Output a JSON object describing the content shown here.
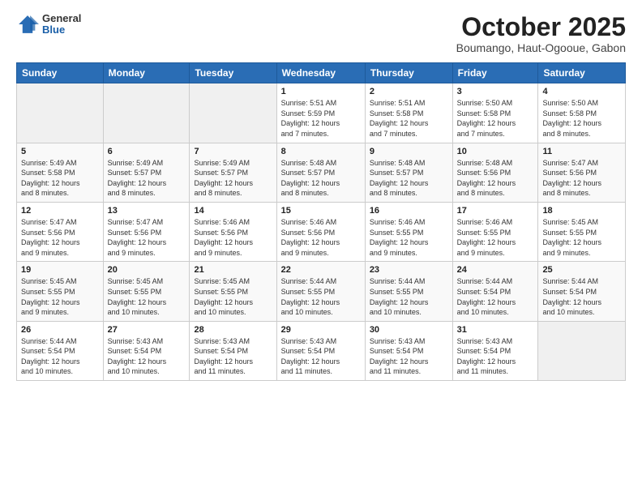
{
  "logo": {
    "general": "General",
    "blue": "Blue"
  },
  "header": {
    "month": "October 2025",
    "location": "Boumango, Haut-Ogooue, Gabon"
  },
  "weekdays": [
    "Sunday",
    "Monday",
    "Tuesday",
    "Wednesday",
    "Thursday",
    "Friday",
    "Saturday"
  ],
  "weeks": [
    [
      {
        "day": "",
        "info": ""
      },
      {
        "day": "",
        "info": ""
      },
      {
        "day": "",
        "info": ""
      },
      {
        "day": "1",
        "info": "Sunrise: 5:51 AM\nSunset: 5:59 PM\nDaylight: 12 hours\nand 7 minutes."
      },
      {
        "day": "2",
        "info": "Sunrise: 5:51 AM\nSunset: 5:58 PM\nDaylight: 12 hours\nand 7 minutes."
      },
      {
        "day": "3",
        "info": "Sunrise: 5:50 AM\nSunset: 5:58 PM\nDaylight: 12 hours\nand 7 minutes."
      },
      {
        "day": "4",
        "info": "Sunrise: 5:50 AM\nSunset: 5:58 PM\nDaylight: 12 hours\nand 8 minutes."
      }
    ],
    [
      {
        "day": "5",
        "info": "Sunrise: 5:49 AM\nSunset: 5:58 PM\nDaylight: 12 hours\nand 8 minutes."
      },
      {
        "day": "6",
        "info": "Sunrise: 5:49 AM\nSunset: 5:57 PM\nDaylight: 12 hours\nand 8 minutes."
      },
      {
        "day": "7",
        "info": "Sunrise: 5:49 AM\nSunset: 5:57 PM\nDaylight: 12 hours\nand 8 minutes."
      },
      {
        "day": "8",
        "info": "Sunrise: 5:48 AM\nSunset: 5:57 PM\nDaylight: 12 hours\nand 8 minutes."
      },
      {
        "day": "9",
        "info": "Sunrise: 5:48 AM\nSunset: 5:57 PM\nDaylight: 12 hours\nand 8 minutes."
      },
      {
        "day": "10",
        "info": "Sunrise: 5:48 AM\nSunset: 5:56 PM\nDaylight: 12 hours\nand 8 minutes."
      },
      {
        "day": "11",
        "info": "Sunrise: 5:47 AM\nSunset: 5:56 PM\nDaylight: 12 hours\nand 8 minutes."
      }
    ],
    [
      {
        "day": "12",
        "info": "Sunrise: 5:47 AM\nSunset: 5:56 PM\nDaylight: 12 hours\nand 9 minutes."
      },
      {
        "day": "13",
        "info": "Sunrise: 5:47 AM\nSunset: 5:56 PM\nDaylight: 12 hours\nand 9 minutes."
      },
      {
        "day": "14",
        "info": "Sunrise: 5:46 AM\nSunset: 5:56 PM\nDaylight: 12 hours\nand 9 minutes."
      },
      {
        "day": "15",
        "info": "Sunrise: 5:46 AM\nSunset: 5:56 PM\nDaylight: 12 hours\nand 9 minutes."
      },
      {
        "day": "16",
        "info": "Sunrise: 5:46 AM\nSunset: 5:55 PM\nDaylight: 12 hours\nand 9 minutes."
      },
      {
        "day": "17",
        "info": "Sunrise: 5:46 AM\nSunset: 5:55 PM\nDaylight: 12 hours\nand 9 minutes."
      },
      {
        "day": "18",
        "info": "Sunrise: 5:45 AM\nSunset: 5:55 PM\nDaylight: 12 hours\nand 9 minutes."
      }
    ],
    [
      {
        "day": "19",
        "info": "Sunrise: 5:45 AM\nSunset: 5:55 PM\nDaylight: 12 hours\nand 9 minutes."
      },
      {
        "day": "20",
        "info": "Sunrise: 5:45 AM\nSunset: 5:55 PM\nDaylight: 12 hours\nand 10 minutes."
      },
      {
        "day": "21",
        "info": "Sunrise: 5:45 AM\nSunset: 5:55 PM\nDaylight: 12 hours\nand 10 minutes."
      },
      {
        "day": "22",
        "info": "Sunrise: 5:44 AM\nSunset: 5:55 PM\nDaylight: 12 hours\nand 10 minutes."
      },
      {
        "day": "23",
        "info": "Sunrise: 5:44 AM\nSunset: 5:55 PM\nDaylight: 12 hours\nand 10 minutes."
      },
      {
        "day": "24",
        "info": "Sunrise: 5:44 AM\nSunset: 5:54 PM\nDaylight: 12 hours\nand 10 minutes."
      },
      {
        "day": "25",
        "info": "Sunrise: 5:44 AM\nSunset: 5:54 PM\nDaylight: 12 hours\nand 10 minutes."
      }
    ],
    [
      {
        "day": "26",
        "info": "Sunrise: 5:44 AM\nSunset: 5:54 PM\nDaylight: 12 hours\nand 10 minutes."
      },
      {
        "day": "27",
        "info": "Sunrise: 5:43 AM\nSunset: 5:54 PM\nDaylight: 12 hours\nand 10 minutes."
      },
      {
        "day": "28",
        "info": "Sunrise: 5:43 AM\nSunset: 5:54 PM\nDaylight: 12 hours\nand 11 minutes."
      },
      {
        "day": "29",
        "info": "Sunrise: 5:43 AM\nSunset: 5:54 PM\nDaylight: 12 hours\nand 11 minutes."
      },
      {
        "day": "30",
        "info": "Sunrise: 5:43 AM\nSunset: 5:54 PM\nDaylight: 12 hours\nand 11 minutes."
      },
      {
        "day": "31",
        "info": "Sunrise: 5:43 AM\nSunset: 5:54 PM\nDaylight: 12 hours\nand 11 minutes."
      },
      {
        "day": "",
        "info": ""
      }
    ]
  ]
}
